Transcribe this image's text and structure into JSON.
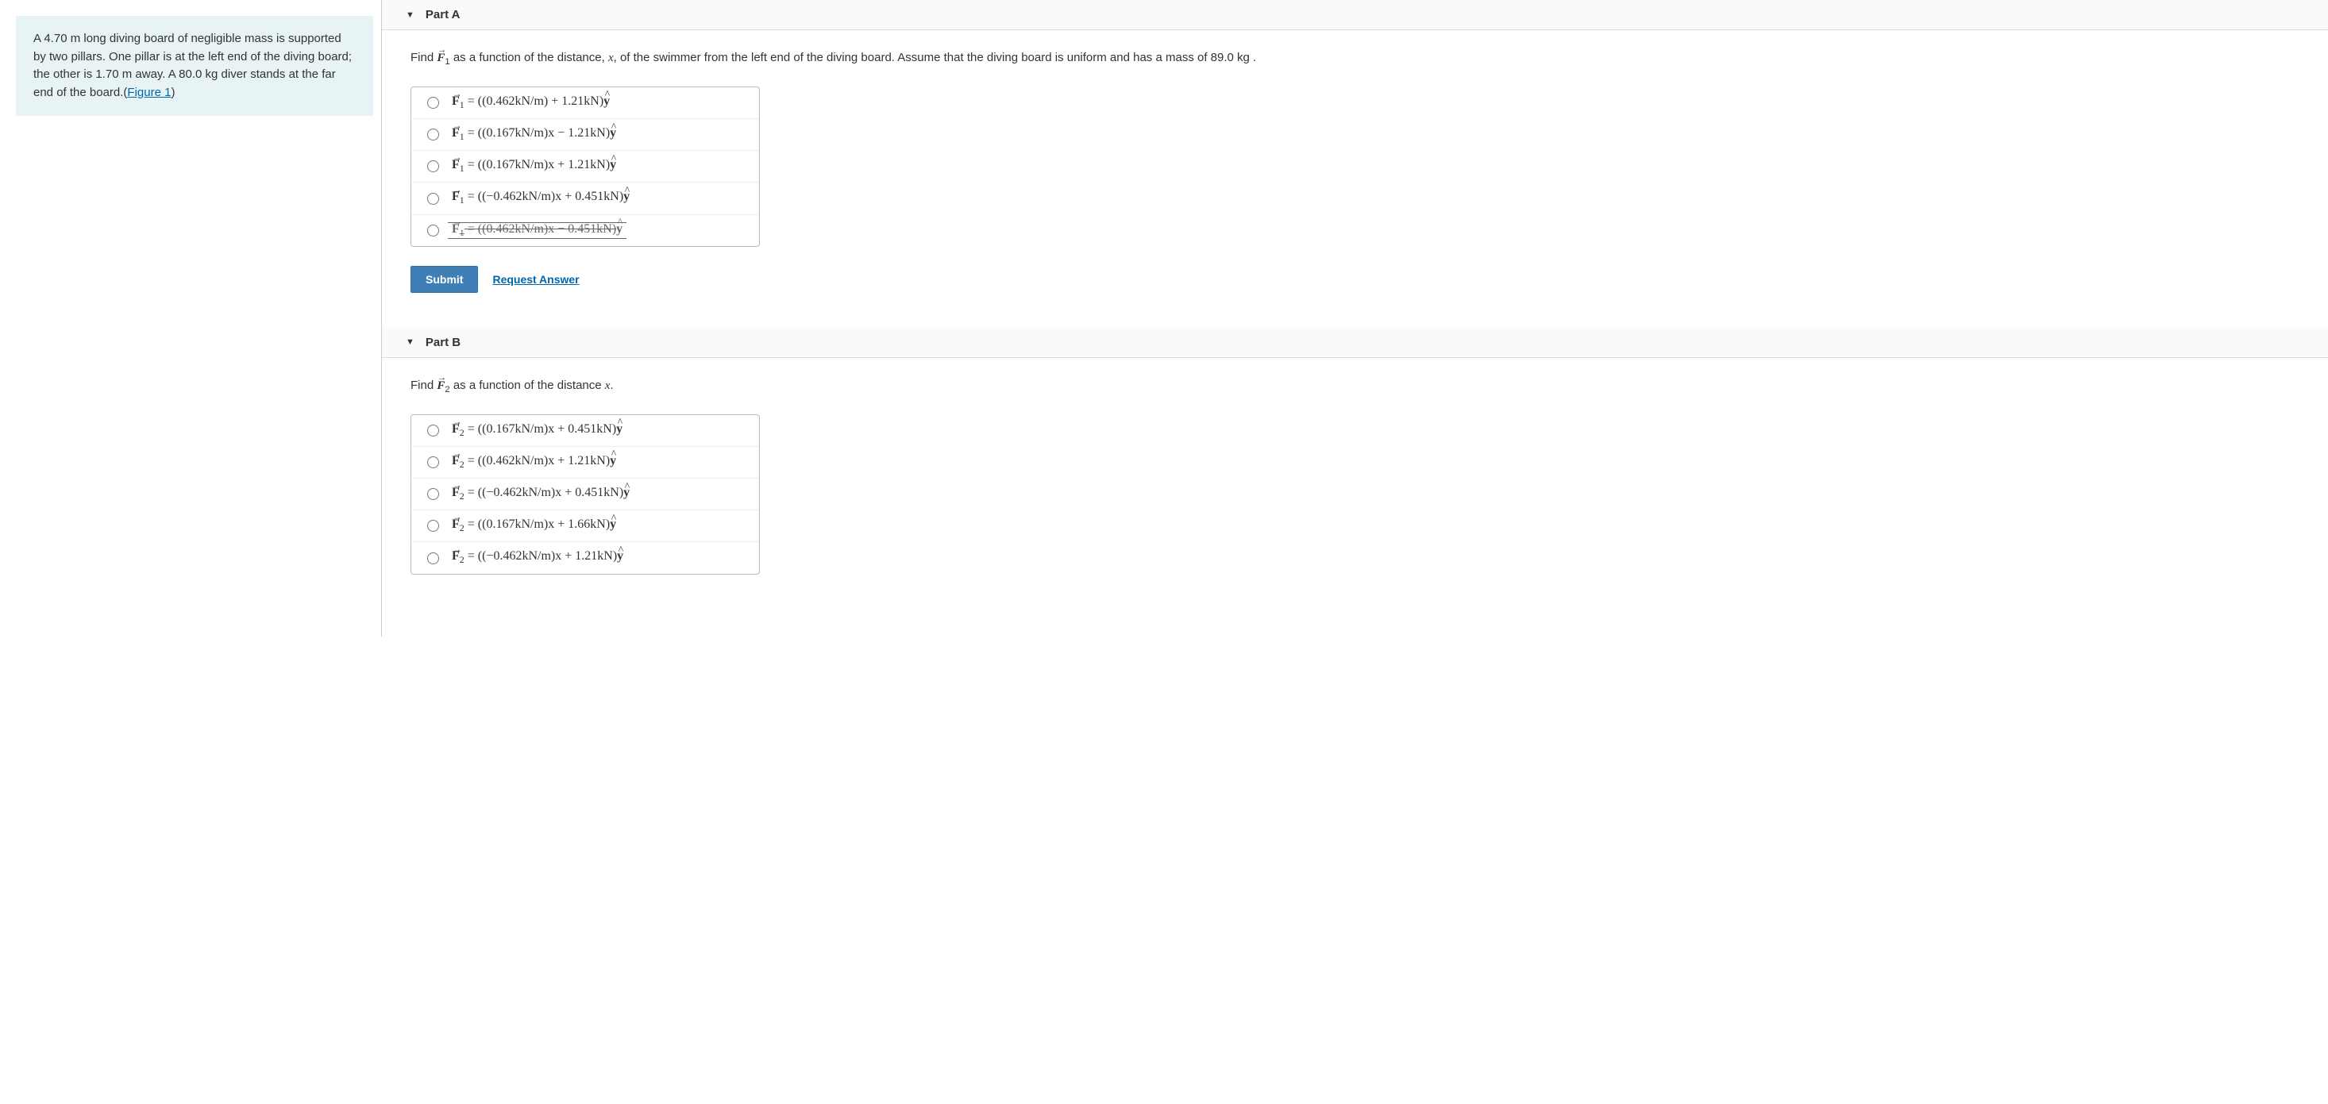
{
  "problem": {
    "text_before_link": "A 4.70 m long diving board of negligible mass is supported by two pillars. One pillar is at the left end of the diving board; the other is 1.70 m away. A 80.0 kg diver stands at the far end of the board.(",
    "link_text": "Figure 1",
    "text_after_link": ")"
  },
  "partA": {
    "title": "Part A",
    "question_prefix": "Find ",
    "question_var": "F",
    "question_sub": "1",
    "question_suffix": " as a function of the distance, x, of the swimmer from the left end of the diving board. Assume that the diving board is uniform and has a mass of 89.0 kg .",
    "options": [
      {
        "var": "F",
        "sub": "1",
        "expr": " = ((0.462kN/m) + 1.21kN)",
        "unit": "y",
        "struck": false
      },
      {
        "var": "F",
        "sub": "1",
        "expr": " = ((0.167kN/m)x − 1.21kN)",
        "unit": "y",
        "struck": false
      },
      {
        "var": "F",
        "sub": "1",
        "expr": " = ((0.167kN/m)x + 1.21kN)",
        "unit": "y",
        "struck": false
      },
      {
        "var": "F",
        "sub": "1",
        "expr": " = ((−0.462kN/m)x + 0.451kN)",
        "unit": "y",
        "struck": false
      },
      {
        "var": "F",
        "sub": "1",
        "expr": " = ((0.462kN/m)x − 0.451kN)",
        "unit": "y",
        "struck": true
      }
    ],
    "submit_label": "Submit",
    "request_label": "Request Answer"
  },
  "partB": {
    "title": "Part B",
    "question_prefix": "Find ",
    "question_var": "F",
    "question_sub": "2",
    "question_suffix": " as a function of the distance x.",
    "options": [
      {
        "var": "F",
        "sub": "2",
        "expr": " = ((0.167kN/m)x + 0.451kN)",
        "unit": "y",
        "struck": false
      },
      {
        "var": "F",
        "sub": "2",
        "expr": " = ((0.462kN/m)x + 1.21kN)",
        "unit": "y",
        "struck": false
      },
      {
        "var": "F",
        "sub": "2",
        "expr": " = ((−0.462kN/m)x + 0.451kN)",
        "unit": "y",
        "struck": false
      },
      {
        "var": "F",
        "sub": "2",
        "expr": " = ((0.167kN/m)x + 1.66kN)",
        "unit": "y",
        "struck": false
      },
      {
        "var": "F",
        "sub": "2",
        "expr": " = ((−0.462kN/m)x + 1.21kN)",
        "unit": "y",
        "struck": false
      }
    ]
  }
}
